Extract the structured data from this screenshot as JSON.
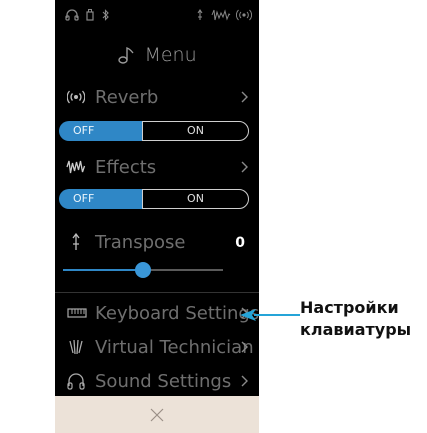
{
  "menu": {
    "title": "Menu",
    "reverb": {
      "label": "Reverb",
      "off_label": "OFF",
      "on_label": "ON",
      "state": "OFF"
    },
    "effects": {
      "label": "Effects",
      "off_label": "OFF",
      "on_label": "ON",
      "state": "OFF"
    },
    "transpose": {
      "label": "Transpose",
      "value": "0",
      "slider_fraction": 0.5
    },
    "items": [
      {
        "label": "Keyboard Settings"
      },
      {
        "label": "Virtual Technician"
      },
      {
        "label": "Sound Settings"
      }
    ]
  },
  "callout": {
    "line1": "Настройки",
    "line2": "клавиатуры"
  },
  "colors": {
    "accent": "#2f87c6",
    "bottom_bar": "#ece2d8",
    "screen_bg": "#000000"
  }
}
